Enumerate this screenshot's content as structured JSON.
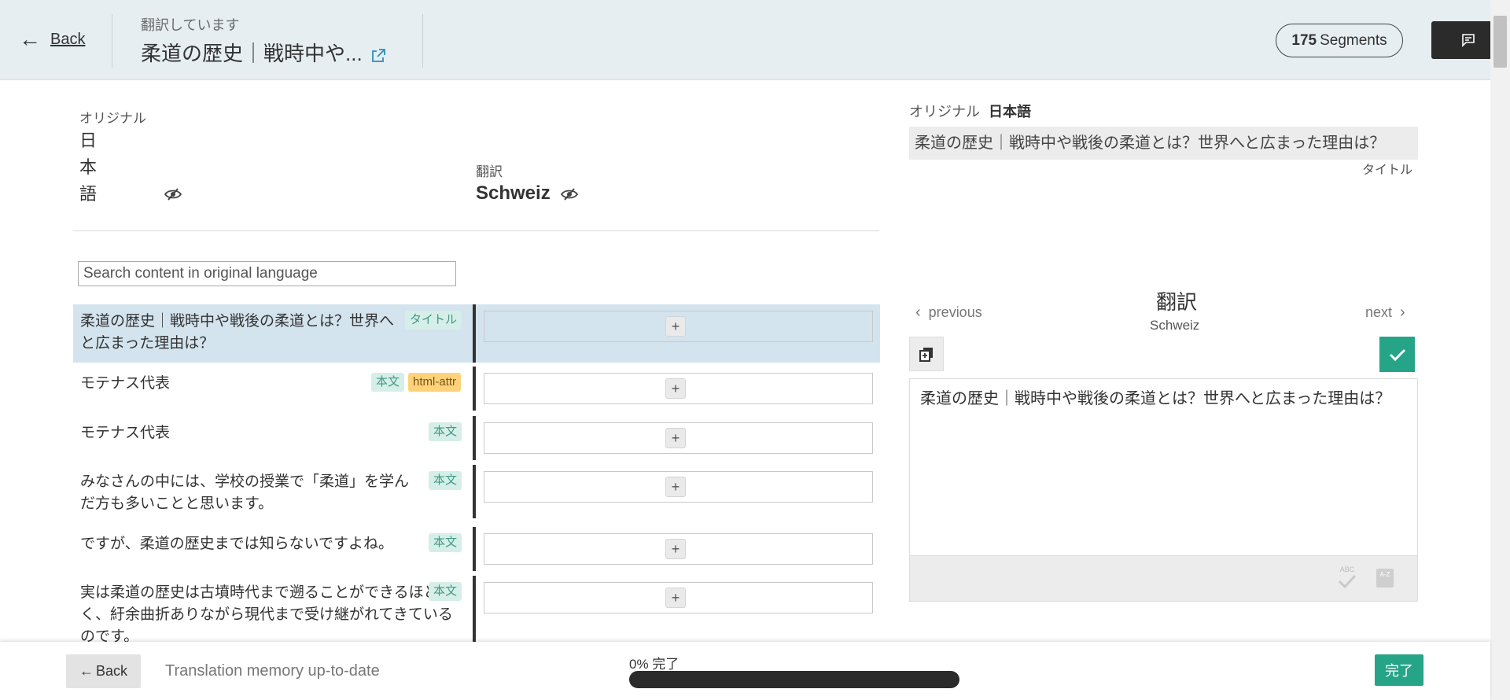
{
  "header": {
    "back_label": "Back",
    "subtitle": "翻訳しています",
    "title": "柔道の歴史｜戦時中や...",
    "segments_count": "175",
    "segments_label": "Segments"
  },
  "list": {
    "original_label": "オリジナル",
    "original_lang_chars": [
      "日",
      "本",
      "語"
    ],
    "translation_label": "翻訳",
    "translation_lang": "Schweiz",
    "search_placeholder": "Search content in original language",
    "rows": [
      {
        "text": "柔道の歴史｜戦時中や戦後の柔道とは？世界へと広まった理由は？",
        "tags": [
          "タイトル"
        ]
      },
      {
        "text": "モテナス代表",
        "tags": [
          "本文",
          "html-attr"
        ]
      },
      {
        "text": "モテナス代表",
        "tags": [
          "本文"
        ]
      },
      {
        "text": "みなさんの中には、学校の授業で「柔道」を学んだ方も多いことと思います。",
        "tags": [
          "本文"
        ]
      },
      {
        "text": "ですが、柔道の歴史までは知らないですよね。",
        "tags": [
          "本文"
        ]
      },
      {
        "text": "実は柔道の歴史は古墳時代まで遡ることができるほど長く、紆余曲折ありながら現代まで受け継がれてきているのです。",
        "tags": [
          "本文"
        ]
      }
    ],
    "plus_label": "+"
  },
  "panel": {
    "original_label": "オリジナル",
    "original_lang": "日本語",
    "original_text": "柔道の歴史｜戦時中や戦後の柔道とは？世界へと広まった理由は？",
    "original_meta": "タイトル",
    "translation_heading": "翻訳",
    "translation_lang": "Schweiz",
    "previous_label": "previous",
    "next_label": "next",
    "editor_text": "柔道の歴史｜戦時中や戦後の柔道とは？世界へと広まった理由は？",
    "spell_label": "ABC",
    "az_label": "A-Z"
  },
  "footer": {
    "back_label": "Back",
    "tm_status": "Translation memory up-to-date",
    "progress_label": "0% 完了",
    "progress_fraction": 0,
    "done_label": "完了"
  },
  "colors": {
    "accent": "#26a488",
    "header_bg": "#e6eef2",
    "selected_row": "#d4e4ee",
    "tag_green_bg": "#d6eee8",
    "tag_orange_bg": "#ffd27a"
  }
}
